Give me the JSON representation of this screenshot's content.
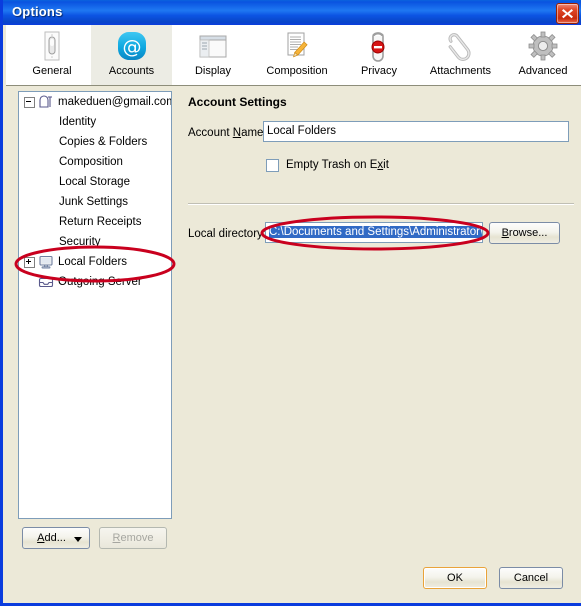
{
  "window": {
    "title": "Options",
    "close_icon": "close-icon",
    "titlebar_color": "#0A53E0",
    "frame_color": "#0A3CDE",
    "dialog_bg": "#ECE9D8"
  },
  "toolbar": {
    "tabs": [
      {
        "label": "General",
        "icon": "light-switch-icon",
        "selected": false
      },
      {
        "label": "Accounts",
        "icon": "at-sign-icon",
        "selected": true
      },
      {
        "label": "Display",
        "icon": "window-layout-icon",
        "selected": false
      },
      {
        "label": "Composition",
        "icon": "document-pencil-icon",
        "selected": false
      },
      {
        "label": "Privacy",
        "icon": "door-hanger-no-entry-icon",
        "selected": false
      },
      {
        "label": "Attachments",
        "icon": "paperclip-icon",
        "selected": false
      },
      {
        "label": "Advanced",
        "icon": "gear-icon",
        "selected": false
      }
    ]
  },
  "tree": {
    "nodes": [
      {
        "label": "makeduen@gmail.com",
        "icon": "mailbox-icon",
        "indent": 0,
        "expander": "minus",
        "selected": false
      },
      {
        "label": "Identity",
        "icon": "none",
        "indent": 1,
        "expander": "none",
        "selected": false
      },
      {
        "label": "Copies & Folders",
        "icon": "none",
        "indent": 1,
        "expander": "none",
        "selected": false
      },
      {
        "label": "Composition",
        "icon": "none",
        "indent": 1,
        "expander": "none",
        "selected": false
      },
      {
        "label": "Local Storage",
        "icon": "none",
        "indent": 1,
        "expander": "none",
        "selected": false
      },
      {
        "label": "Junk Settings",
        "icon": "none",
        "indent": 1,
        "expander": "none",
        "selected": false
      },
      {
        "label": "Return Receipts",
        "icon": "none",
        "indent": 1,
        "expander": "none",
        "selected": false
      },
      {
        "label": "Security",
        "icon": "none",
        "indent": 1,
        "expander": "none",
        "selected": false
      },
      {
        "label": "Local Folders",
        "icon": "computer-icon",
        "indent": 0,
        "expander": "plus",
        "selected": false
      },
      {
        "label": "Outgoing Server",
        "icon": "outbox-tray-icon",
        "indent": 0,
        "expander": "none",
        "selected": false
      }
    ]
  },
  "tree_buttons": {
    "add_label": "Add...",
    "add_arrow_icon": "chevron-down-icon",
    "remove_label": "Remove",
    "remove_disabled": true
  },
  "pane": {
    "title": "Account Settings",
    "account_name": {
      "label_pre": "Account ",
      "label_accel": "N",
      "label_post": "ame:",
      "value": "Local Folders"
    },
    "empty_trash": {
      "label_pre": "Empty Trash on E",
      "label_accel": "x",
      "label_post": "it",
      "checked": false
    },
    "local_directory": {
      "label": "Local directory:",
      "value": "C:\\Documents and Settings\\Administrator\\A",
      "selected": true,
      "selection_color": "#316AC5"
    },
    "browse": {
      "label_accel": "B",
      "label_post": "rowse..."
    }
  },
  "footer": {
    "ok_label": "OK",
    "cancel_label": "Cancel",
    "ok_is_default": true,
    "default_border_color": "#E9A33A"
  },
  "annotations": [
    {
      "name": "local-folders-highlight",
      "shape": "ellipse",
      "color": "#C9001E"
    },
    {
      "name": "local-directory-highlight",
      "shape": "ellipse",
      "color": "#C9001E"
    }
  ]
}
